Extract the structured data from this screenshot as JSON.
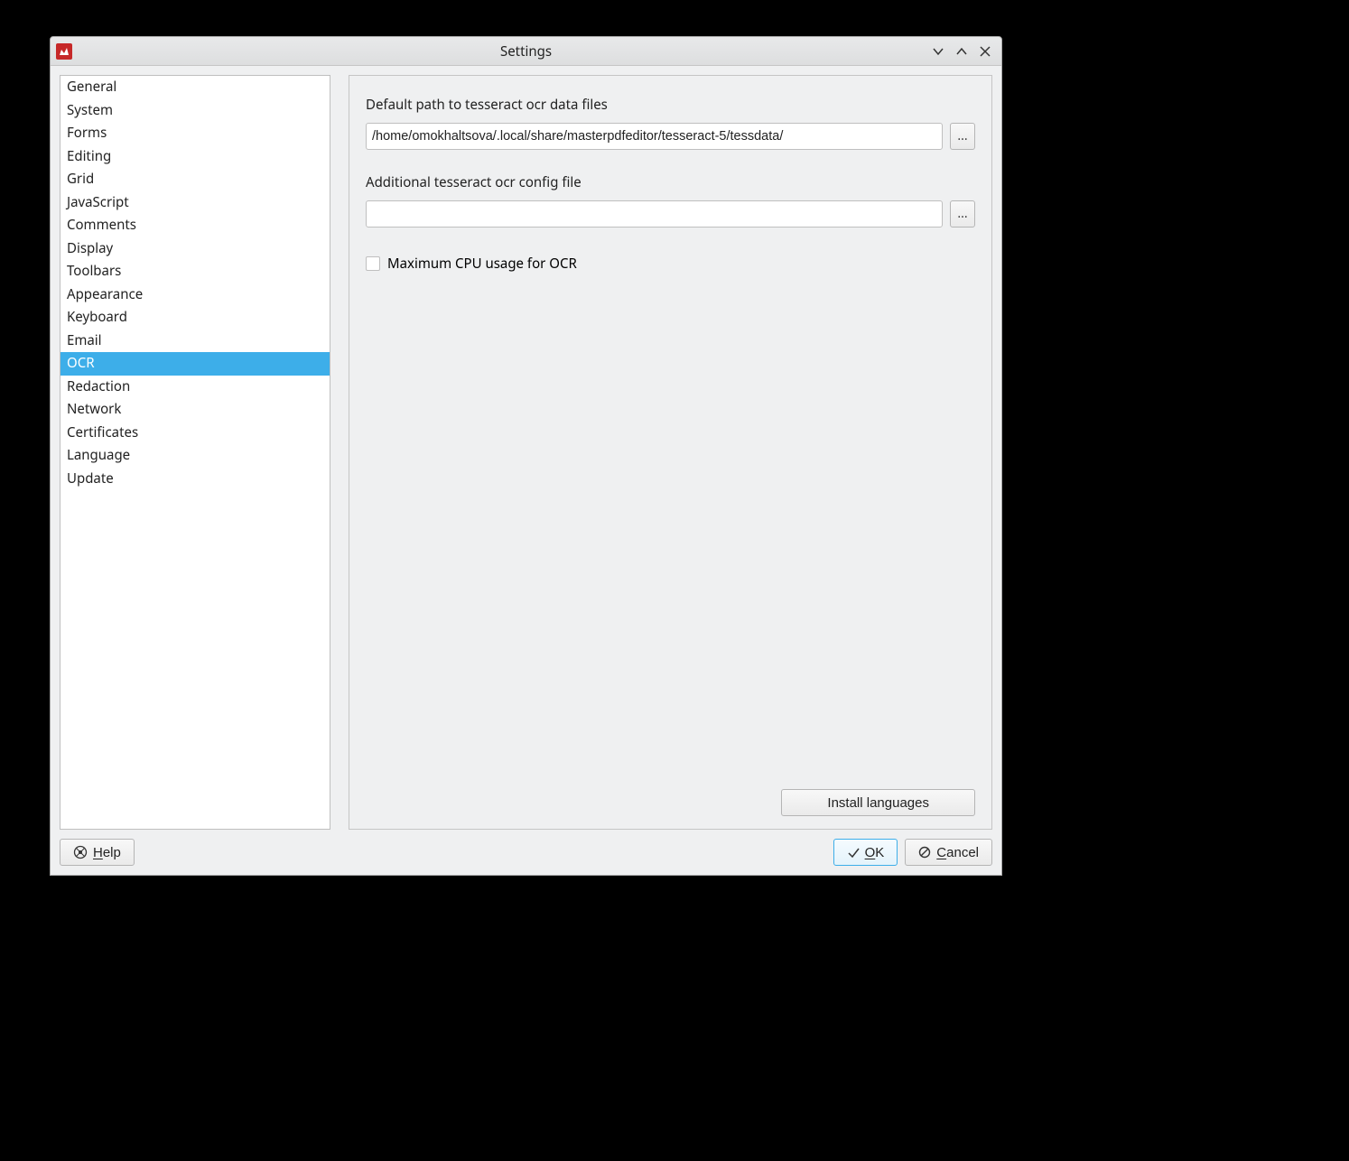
{
  "window": {
    "title": "Settings"
  },
  "sidebar": {
    "items": [
      "General",
      "System",
      "Forms",
      "Editing",
      "Grid",
      "JavaScript",
      "Comments",
      "Display",
      "Toolbars",
      "Appearance",
      "Keyboard",
      "Email",
      "OCR",
      "Redaction",
      "Network",
      "Certificates",
      "Language",
      "Update"
    ],
    "selected_index": 12
  },
  "content": {
    "tessdata_label": "Default path to tesseract ocr data files",
    "tessdata_value": "/home/omokhaltsova/.local/share/masterpdfeditor/tesseract-5/tessdata/",
    "config_label": "Additional tesseract ocr config file",
    "config_value": "",
    "max_cpu_label": "Maximum CPU usage for OCR",
    "max_cpu_checked": false,
    "browse_label": "...",
    "install_label": "Install languages"
  },
  "footer": {
    "help_label": "Help",
    "ok_label": "OK",
    "cancel_label": "Cancel"
  }
}
